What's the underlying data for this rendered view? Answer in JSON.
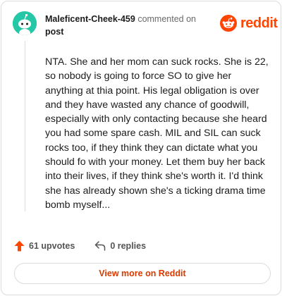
{
  "header": {
    "username": "Maleficent-Cheek-459",
    "action_text": "commented on",
    "target": "post"
  },
  "brand": {
    "name": "reddit",
    "icon": "reddit-logo-icon",
    "color": "#ff4500"
  },
  "avatar": {
    "icon": "snoo-avatar-icon",
    "color": "#24c7a6"
  },
  "comment": {
    "text": "NTA. She and her mom can suck rocks. She is 22, so nobody is going to force SO to give her anything at thia point. His legal obligation is over and they have wasted any chance of goodwill, especially with only contacting because she heard you had some spare cash. MIL and SIL can suck rocks too, if they think they can dictate what you should fo with your money. Let them buy her back into their lives, if they think she's worth it. I'd think she has already shown she's a ticking drama time bomb myself..."
  },
  "stats": {
    "upvotes_label": "61 upvotes",
    "replies_label": "0 replies",
    "upvote_icon": "upvote-arrow-icon",
    "reply_icon": "reply-arrow-icon",
    "upvote_color": "#ff4500"
  },
  "footer": {
    "view_more_label": "View more on Reddit",
    "view_more_color": "#d93a00"
  }
}
